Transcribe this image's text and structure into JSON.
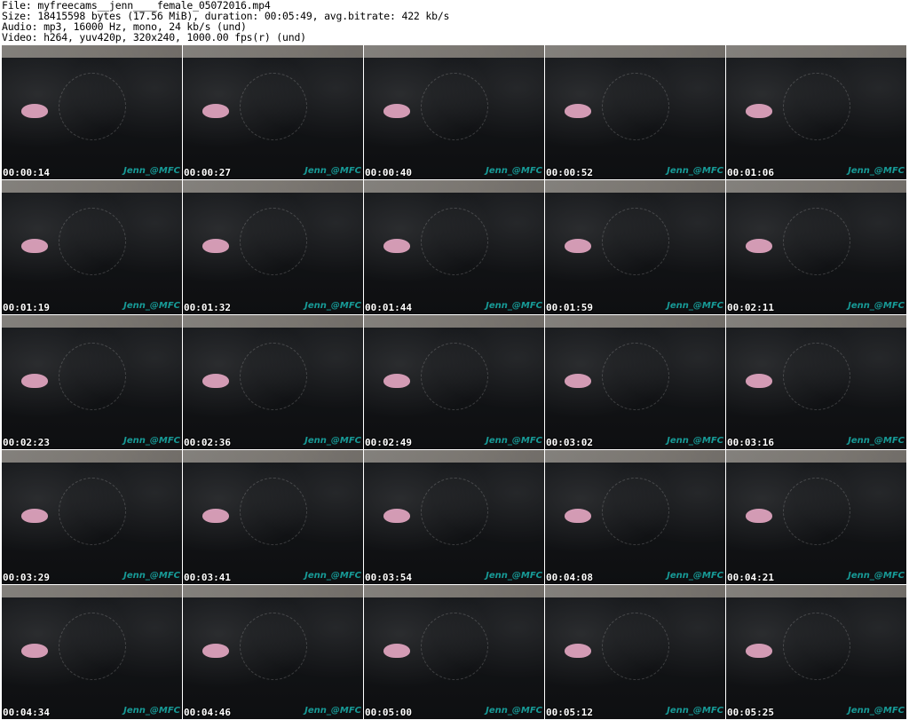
{
  "header": {
    "lines": [
      "File: myfreecams__jenn____female_05072016.mp4",
      "Size: 18415598 bytes (17.56 MiB), duration: 00:05:49, avg.bitrate: 422 kb/s",
      "Audio: mp3, 16000 Hz, mono, 24 kb/s (und)",
      "Video: h264, yuv420p, 320x240, 1000.00 fps(r) (und)"
    ]
  },
  "watermark": "Jenn_@MFC",
  "frames": [
    {
      "time": "00:00:14"
    },
    {
      "time": "00:00:27"
    },
    {
      "time": "00:00:40"
    },
    {
      "time": "00:00:52"
    },
    {
      "time": "00:01:06"
    },
    {
      "time": "00:01:19"
    },
    {
      "time": "00:01:32"
    },
    {
      "time": "00:01:44"
    },
    {
      "time": "00:01:59"
    },
    {
      "time": "00:02:11"
    },
    {
      "time": "00:02:23"
    },
    {
      "time": "00:02:36"
    },
    {
      "time": "00:02:49"
    },
    {
      "time": "00:03:02"
    },
    {
      "time": "00:03:16"
    },
    {
      "time": "00:03:29"
    },
    {
      "time": "00:03:41"
    },
    {
      "time": "00:03:54"
    },
    {
      "time": "00:04:08"
    },
    {
      "time": "00:04:21"
    },
    {
      "time": "00:04:34"
    },
    {
      "time": "00:04:46"
    },
    {
      "time": "00:05:00"
    },
    {
      "time": "00:05:12"
    },
    {
      "time": "00:05:25"
    }
  ]
}
